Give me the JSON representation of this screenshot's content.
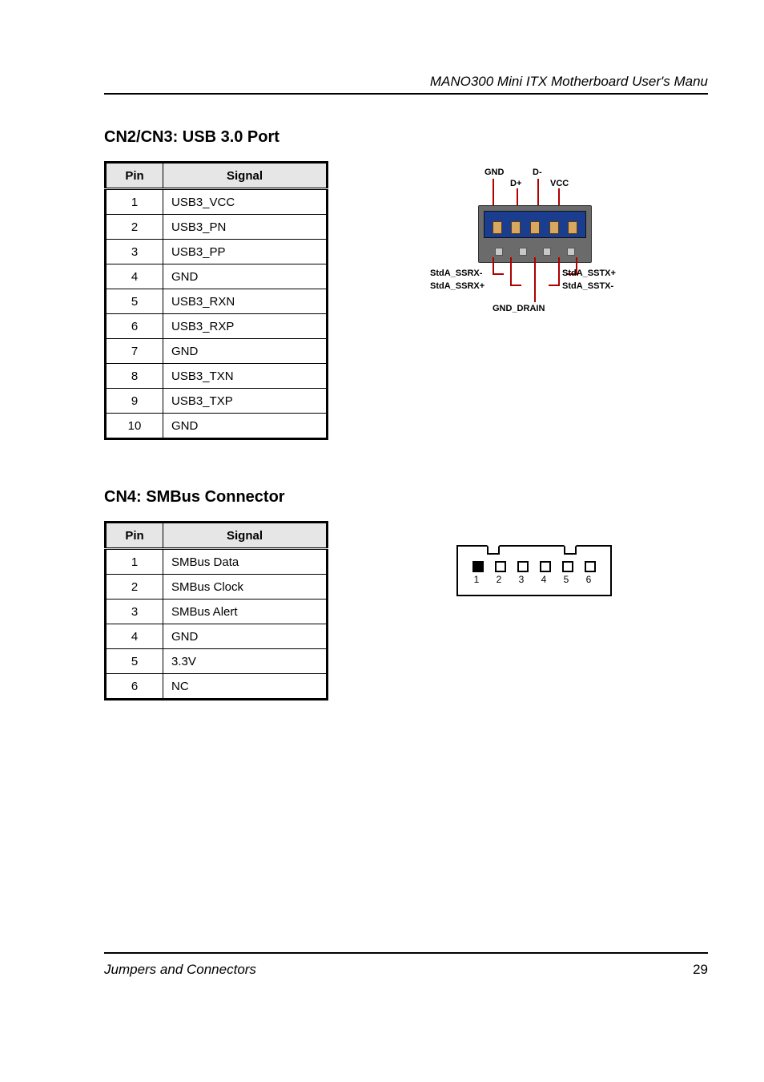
{
  "header": {
    "right": "MANO300 Mini ITX Motherboard User's Manu"
  },
  "footer": {
    "left": "Jumpers and Connectors",
    "right": "29"
  },
  "tableHeaders": {
    "pin": "Pin",
    "signal": "Signal"
  },
  "usb3": {
    "title": "CN2/CN3: USB 3.0 Port",
    "pins": [
      {
        "pin": "1",
        "signal": "USB3_VCC"
      },
      {
        "pin": "2",
        "signal": "USB3_PN"
      },
      {
        "pin": "3",
        "signal": "USB3_PP"
      },
      {
        "pin": "4",
        "signal": "GND"
      },
      {
        "pin": "5",
        "signal": "USB3_RXN"
      },
      {
        "pin": "6",
        "signal": "USB3_RXP"
      },
      {
        "pin": "7",
        "signal": "GND"
      },
      {
        "pin": "8",
        "signal": "USB3_TXN"
      },
      {
        "pin": "9",
        "signal": "USB3_TXP"
      },
      {
        "pin": "10",
        "signal": "GND"
      }
    ],
    "figLabels": {
      "gnd": "GND",
      "dplus": "D+",
      "dminus": "D-",
      "vcc": "VCC",
      "ssrxm": "StdA_SSRX-",
      "ssrxp": "StdA_SSRX+",
      "gnddrain": "GND_DRAIN",
      "sstxm": "StdA_SSTX-",
      "sstxp": "StdA_SSTX+"
    }
  },
  "cn4": {
    "title": "CN4: SMBus Connector",
    "pins": [
      {
        "pin": "1",
        "signal": "SMBus Data"
      },
      {
        "pin": "2",
        "signal": "SMBus Clock"
      },
      {
        "pin": "3",
        "signal": "SMBus Alert"
      },
      {
        "pin": "4",
        "signal": "GND"
      },
      {
        "pin": "5",
        "signal": "3.3V"
      },
      {
        "pin": "6",
        "signal": "NC"
      }
    ],
    "figPins": [
      "1",
      "2",
      "3",
      "4",
      "5",
      "6"
    ]
  }
}
